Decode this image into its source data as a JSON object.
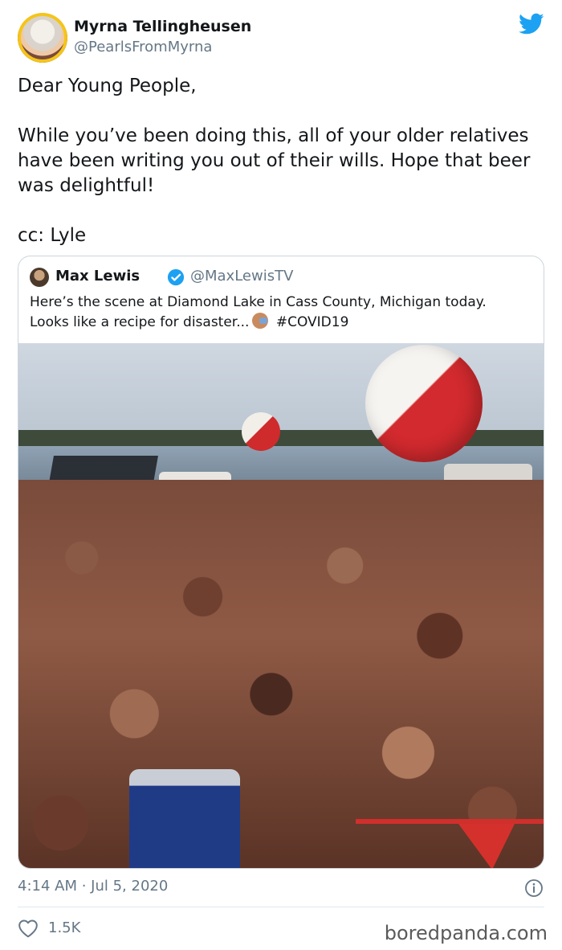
{
  "tweet": {
    "author_name": "Myrna Tellingheusen",
    "author_handle": "@PearlsFromMyrna",
    "text_lines": [
      "Dear Young People,",
      "While you’ve been doing this, all of your older relatives have been  writing you out of their wills. Hope that beer was delightful!",
      "cc: Lyle"
    ],
    "timestamp": "4:14 AM · Jul 5, 2020",
    "likes": "1.5K"
  },
  "quoted_tweet": {
    "author_name": "Max Lewis",
    "author_handle": "@MaxLewisTV",
    "text_before_emoji": "Here’s the scene at Diamond Lake in Cass County, Michigan today. Looks like a recipe for disaster...",
    "text_after_emoji": "#COVID19",
    "emoji": "facepalm-emoji"
  },
  "icons": {
    "twitter": "twitter-bird-icon",
    "verified": "verified-badge-icon",
    "info": "info-icon",
    "heart": "heart-icon"
  },
  "colors": {
    "twitter_blue": "#1da1f2",
    "text_primary": "#14171a",
    "text_secondary": "#657786"
  },
  "watermark": "boredpanda.com"
}
